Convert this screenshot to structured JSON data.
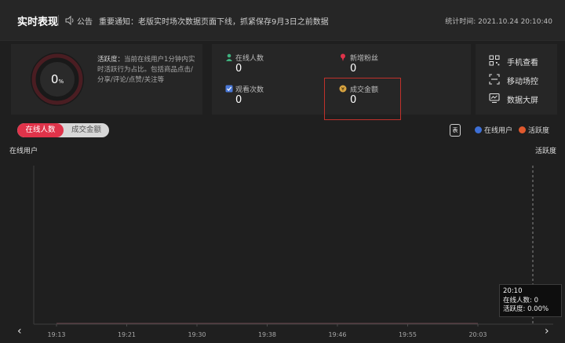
{
  "header": {
    "title": "实时表现",
    "notice_label": "公告",
    "notice_text": "重要通知：老版实时场次数据页面下线，抓紧保存9月3日之前数据",
    "stat_time": "统计时间: 2021.10.24 20:10:40"
  },
  "activity": {
    "gauge_value": "0",
    "gauge_unit": "%",
    "gauge_level": 0,
    "desc_title": "活跃度：",
    "desc_text": "当前在线用户1分钟内实时活跃行为占比。包括商品点击/分享/评论/点赞/关注等"
  },
  "metrics": [
    {
      "label": "在线人数",
      "value": "0",
      "icon": "person-icon",
      "color": "#3fb27f"
    },
    {
      "label": "新增粉丝",
      "value": "0",
      "icon": "pin-icon",
      "color": "#e0334a"
    },
    {
      "label": "观看次数",
      "value": "0",
      "icon": "checkbox-icon",
      "color": "#4a78d8"
    },
    {
      "label": "成交金额",
      "value": "0",
      "icon": "coin-icon",
      "color": "#d9a441"
    }
  ],
  "side_actions": [
    {
      "label": "手机查看",
      "icon": "qr-code-icon"
    },
    {
      "label": "移动场控",
      "icon": "scan-icon"
    },
    {
      "label": "数据大屏",
      "icon": "monitor-icon"
    }
  ],
  "toggle": {
    "active": "在线人数",
    "inactive": "成交金额"
  },
  "table_button": "表",
  "legend": [
    {
      "label": "在线用户",
      "color": "#3d6fd6"
    },
    {
      "label": "活跃度",
      "color": "#e0592e"
    }
  ],
  "chart_data": {
    "type": "line",
    "x": [
      "19:13",
      "19:21",
      "19:30",
      "19:38",
      "19:46",
      "19:55",
      "20:03"
    ],
    "series": [
      {
        "name": "在线用户",
        "values": [
          0,
          0,
          0,
          0,
          0,
          0,
          0
        ]
      },
      {
        "name": "活跃度",
        "values": [
          0,
          0,
          0,
          0,
          0,
          0,
          0
        ]
      }
    ],
    "ylabel_left": "在线用户",
    "ylabel_right": "活跃度",
    "legend_position": "top-right"
  },
  "tooltip": {
    "time": "20:10",
    "online_line": "在线人数: 0",
    "activity_line": "活跃度: 0.00%"
  },
  "nav": {
    "prev": "‹",
    "next": "›"
  },
  "colors": {
    "background": "#1f1f1f",
    "panel": "#262626",
    "accent": "#e0334a",
    "highlight": "#c0312b"
  }
}
